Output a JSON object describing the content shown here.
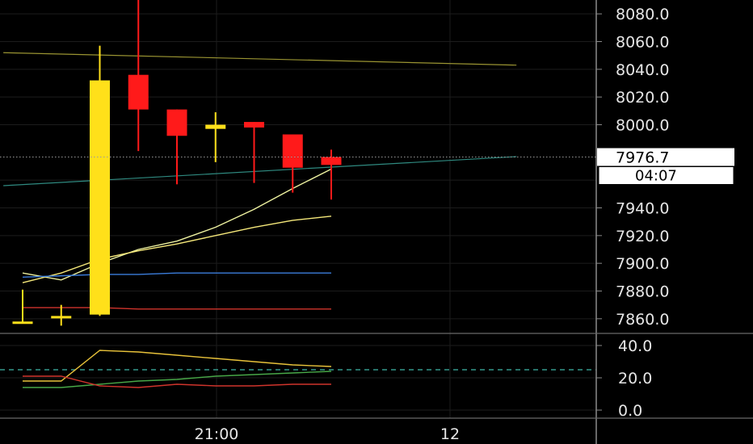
{
  "chart_data": {
    "type": "candlestick",
    "price_axis": {
      "ylim": [
        7850,
        8090
      ],
      "ticks": [
        "8080.0",
        "8060.0",
        "8040.0",
        "8020.0",
        "8000.0",
        "7940.0",
        "7920.0",
        "7900.0",
        "7880.0",
        "7860.0"
      ],
      "tick_values": [
        8080,
        8060,
        8040,
        8020,
        8000,
        7940,
        7920,
        7900,
        7880,
        7860
      ],
      "current_price_label": "7976.7",
      "current_price": 7976.7,
      "countdown_label": "04:07"
    },
    "time_axis": {
      "labels": [
        "21:00",
        "12"
      ]
    },
    "candles": [
      {
        "open": 7858,
        "high": 7881,
        "low": 7857,
        "close": 7858
      },
      {
        "open": 7861,
        "high": 7870,
        "low": 7855,
        "close": 7862
      },
      {
        "open": 7863,
        "high": 8057,
        "low": 7862,
        "close": 8032
      },
      {
        "open": 8036,
        "high": 8090,
        "low": 7981,
        "close": 8011
      },
      {
        "open": 8011,
        "high": 8011,
        "low": 7957,
        "close": 7992
      },
      {
        "open": 7997,
        "high": 8009,
        "low": 7973,
        "close": 8000
      },
      {
        "open": 8002,
        "high": 8002,
        "low": 7958,
        "close": 7998
      },
      {
        "open": 7993,
        "high": 7993,
        "low": 7951,
        "close": 7969
      },
      {
        "open": 7976.7,
        "high": 7982,
        "low": 7946,
        "close": 7971
      }
    ],
    "overlay_lines": [
      {
        "color": "#eef2a0",
        "values": [
          7893,
          7888,
          7900,
          7910,
          7916,
          7926,
          7939,
          7954,
          7968
        ]
      },
      {
        "color": "#f5e87a",
        "values": [
          7886,
          7893,
          7903,
          7909,
          7914,
          7920,
          7926,
          7931,
          7934
        ]
      },
      {
        "color": "#3b7ddb",
        "values": [
          7890,
          7891,
          7892,
          7892,
          7893,
          7893,
          7893,
          7893,
          7893
        ]
      },
      {
        "color": "#d0342c",
        "values": [
          7868,
          7868,
          7868,
          7867,
          7867,
          7867,
          7867,
          7867,
          7867
        ]
      }
    ],
    "trend_lines": [
      {
        "color": "#9a9432",
        "from": [
          -0.5,
          8052
        ],
        "to": [
          12.8,
          8043
        ]
      },
      {
        "color": "#2f8a80",
        "from": [
          -0.5,
          7956
        ],
        "to": [
          12.8,
          7977
        ]
      }
    ],
    "oscillator": {
      "ylim": [
        -5,
        47
      ],
      "ticks": [
        "40.0",
        "20.0",
        "0.0"
      ],
      "tick_values": [
        40,
        20,
        0
      ],
      "dashed_level": 25,
      "series": [
        {
          "color": "#e8c23a",
          "values": [
            18,
            18,
            37,
            36,
            34,
            32,
            30,
            28,
            27
          ]
        },
        {
          "color": "#48a848",
          "values": [
            14,
            14,
            16,
            18,
            19,
            21,
            22,
            23,
            24
          ]
        },
        {
          "color": "#d0342c",
          "values": [
            21,
            21,
            15,
            14,
            16,
            15,
            15,
            16,
            16
          ]
        }
      ]
    }
  },
  "colors": {
    "background": "#000000",
    "bull": "#ffe01a",
    "bear": "#ff1a1a",
    "grid": "#1c1c1c",
    "axis_line": "#8a8a8a",
    "text": "#e6e6e6",
    "dashed_level": "#3fb7a8"
  }
}
